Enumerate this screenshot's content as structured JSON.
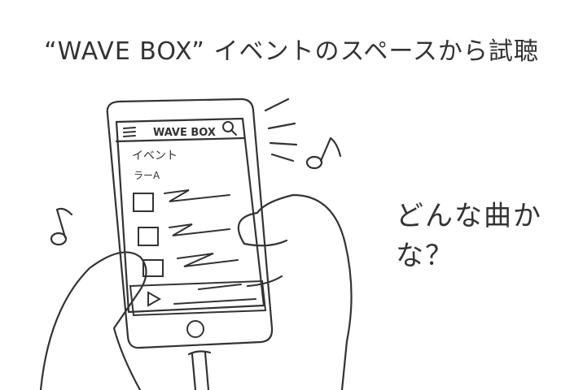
{
  "caption": "“WAVE BOX” イベントのスペースから試聴",
  "aside_text": "どんな曲かな？",
  "phone": {
    "app_title": "WAVE BOX",
    "section_label": "イベント",
    "subsection_label": "ラーA",
    "icons": [
      "menu-icon",
      "search-icon",
      "play-icon",
      "home-button-icon"
    ]
  }
}
